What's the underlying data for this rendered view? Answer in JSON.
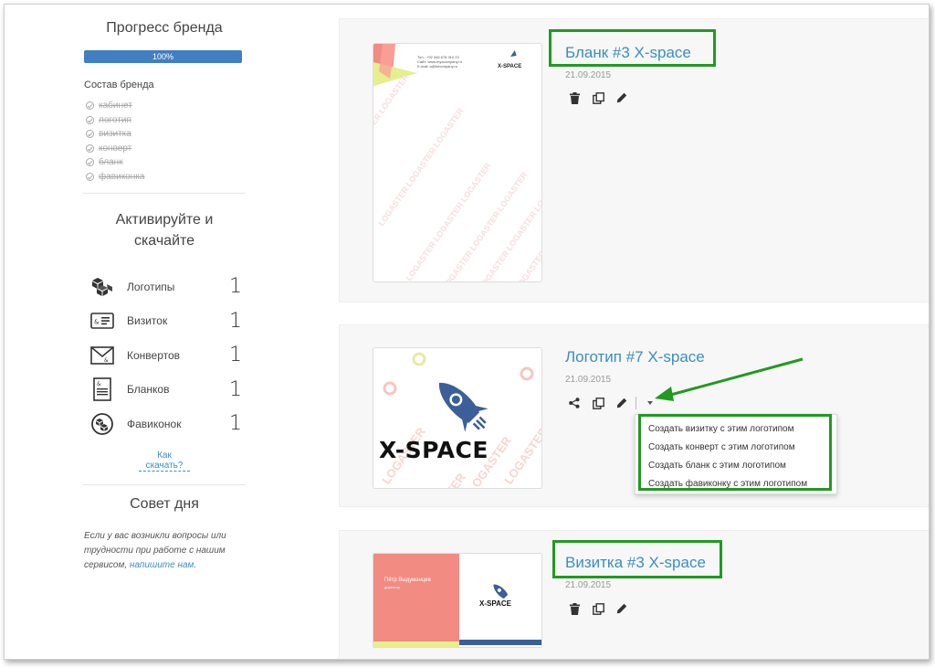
{
  "sidebar": {
    "progress_title": "Прогресс бренда",
    "progress_value": "100%",
    "progress_fraction": 1.0,
    "composition_title": "Состав бренда",
    "composition_items": [
      "кабинет",
      "логотип",
      "визитка",
      "конверт",
      "бланк",
      "фавиконка"
    ],
    "activate_heading_line1": "Активируйте и",
    "activate_heading_line2": "скачайте",
    "stats": [
      {
        "label": "Логотипы",
        "value": "1",
        "icon": "cubes-icon"
      },
      {
        "label": "Визиток",
        "value": "1",
        "icon": "business-card-icon"
      },
      {
        "label": "Конвертов",
        "value": "1",
        "icon": "envelope-icon"
      },
      {
        "label": "Бланков",
        "value": "1",
        "icon": "letterhead-icon"
      },
      {
        "label": "Фавиконок",
        "value": "1",
        "icon": "favicon-icon"
      }
    ],
    "how_download_link": "Как скачать?",
    "tip_title": "Совет дня",
    "tip_text": "Если у вас возникли вопросы или трудности при работе с нашим сервисом, ",
    "tip_link": "напишите нам",
    "tip_end": "."
  },
  "cards": [
    {
      "title": "Бланк #3 X-space",
      "date": "21.09.2015",
      "actions": [
        "trash-icon",
        "copy-icon",
        "pencil-icon"
      ]
    },
    {
      "title": "Логотип #7 X-space",
      "date": "21.09.2015",
      "actions": [
        "share-icon",
        "copy-icon",
        "pencil-icon",
        "chevron-down-icon"
      ]
    },
    {
      "title": "Визитка #3 X-space",
      "date": "21.09.2015",
      "actions": [
        "trash-icon",
        "copy-icon",
        "pencil-icon"
      ]
    }
  ],
  "thumbnails": {
    "letterhead_brand": "X-SPACE",
    "letterhead_contact": [
      "Тел.: +92 345 678 910 23",
      "Сайт: www.myxcompany.ru",
      "E-mail: a@brbcmpany.ru"
    ],
    "logo_brand": "X-SPACE",
    "logo_watermark": "LOGASTER",
    "card_brand": "X-SPACE",
    "card_person": "Пётр Выдуманцев",
    "card_role": "директор"
  },
  "dropdown": {
    "items": [
      "Создать визитку с этим логотипом",
      "Создать конверт с этим логотипом",
      "Создать бланк с этим логотипом",
      "Создать фавиконку с этим логотипом"
    ]
  },
  "colors": {
    "accent": "#3a8ec4",
    "progress": "#3f7fc2",
    "highlight": "#1f9b1f",
    "card_bg": "#f7f7f7",
    "salmon": "#f28b82"
  }
}
